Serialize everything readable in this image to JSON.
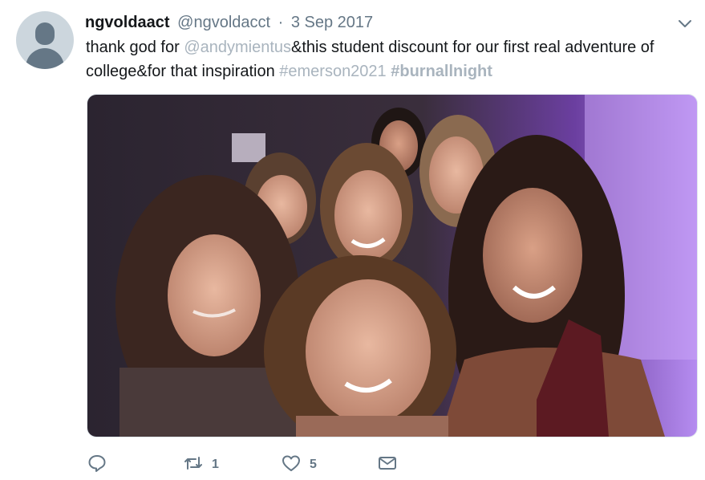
{
  "tweet": {
    "display_name": "ngvoldaact",
    "handle": "@ngvoldacct",
    "separator": "·",
    "date": "3 Sep 2017",
    "text_parts": {
      "p1": "thank god for ",
      "mention": "@andymientus",
      "p2": "&this student discount for our first real adventure of college&for that inspiration ",
      "hashtag1": "#emerson2021",
      "space": " ",
      "hashtag2": "#burnallnight"
    },
    "icons": {
      "menu": "chevron-down-icon",
      "reply": "reply-icon",
      "retweet": "retweet-icon",
      "like": "heart-icon",
      "message": "envelope-icon"
    },
    "retweet_count": "1",
    "like_count": "5"
  },
  "colors": {
    "text": "#14171a",
    "secondary": "#657786",
    "link_faded": "#a9b4be",
    "avatar_bg": "#ccd6dd"
  }
}
